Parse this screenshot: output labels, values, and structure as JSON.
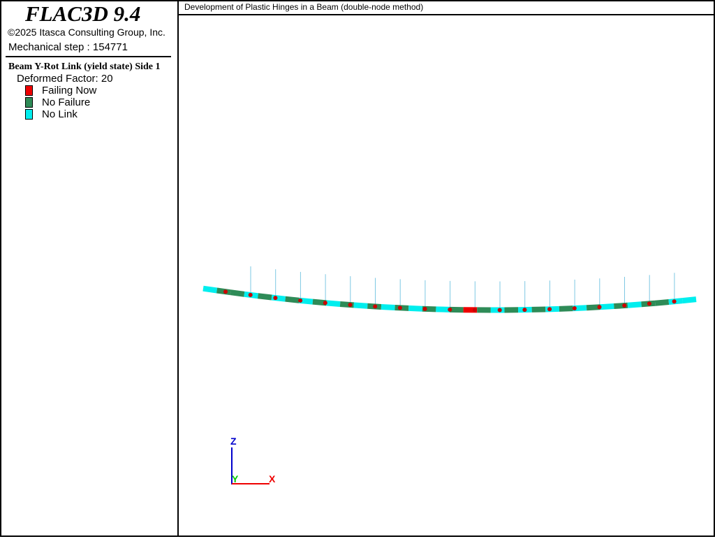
{
  "window": {
    "app_title": "FLAC3D 9.4",
    "copyright": "©2025 Itasca Consulting Group, Inc.",
    "mechanical_step": "Mechanical step : 154771"
  },
  "plot": {
    "title": "Beam Y-Rot Link (yield state) Side 1",
    "deformed_factor": "Deformed Factor: 20",
    "legend": [
      {
        "label": "Failing Now",
        "color": "#ee0000"
      },
      {
        "label": "No Failure",
        "color": "#2e8b57"
      },
      {
        "label": "No Link",
        "color": "#00eeee"
      }
    ]
  },
  "view": {
    "title": "Development of Plastic Hinges in a Beam (double-node method)",
    "axes": {
      "z_label": "Z",
      "y_label": "Y",
      "x_label": "X"
    },
    "colors": {
      "support": "#7ec8e3",
      "node": "#cc0000",
      "z_axis": "#0000cc",
      "y_axis": "#00cc00",
      "x_axis": "#ee0000"
    },
    "beam_segment_states": [
      "No Link",
      "No Failure",
      "No Failure",
      "No Link",
      "No Failure",
      "No Link",
      "No Failure",
      "No Link",
      "No Failure",
      "No Link",
      "No Failure",
      "No Link",
      "No Failure",
      "No Link",
      "No Failure",
      "No Link",
      "No Failure",
      "No Link",
      "No Failure",
      "Failing Now",
      "No Failure",
      "No Link",
      "No Failure",
      "No Link",
      "No Failure",
      "No Link",
      "No Failure",
      "No Link",
      "No Failure",
      "No Link",
      "No Failure",
      "No Link",
      "No Failure",
      "No Failure",
      "No Link",
      "No Link"
    ]
  }
}
